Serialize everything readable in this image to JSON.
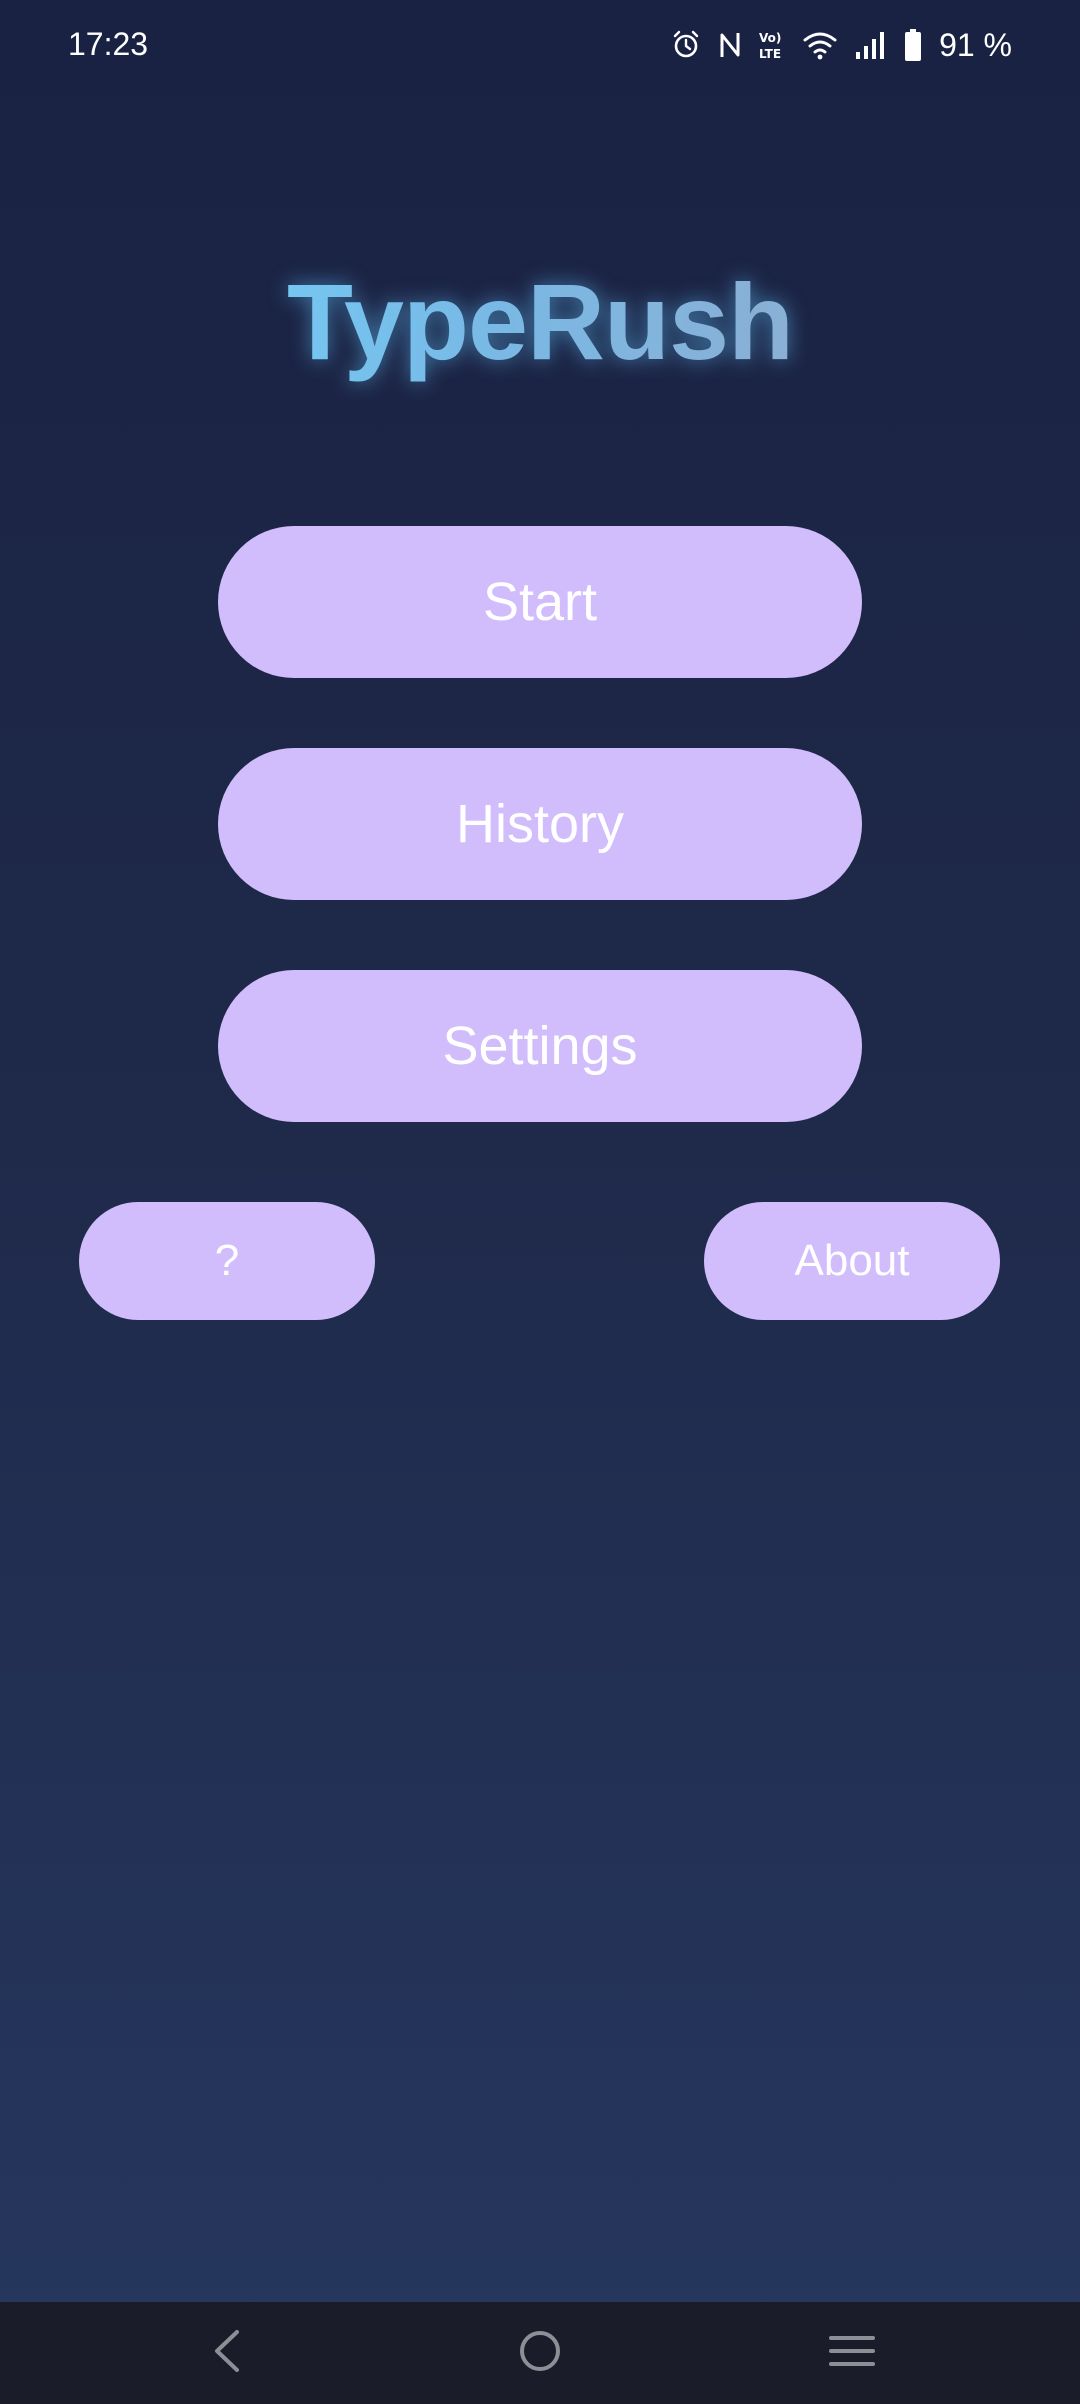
{
  "status_bar": {
    "time": "17:23",
    "battery": "91 %",
    "icons": [
      "alarm-icon",
      "nfc-icon",
      "volte-icon",
      "wifi-icon",
      "signal-icon",
      "battery-icon"
    ]
  },
  "app": {
    "title": "TypeRush"
  },
  "menu": {
    "start_label": "Start",
    "history_label": "History",
    "settings_label": "Settings",
    "help_label": "?",
    "about_label": "About"
  },
  "nav_bar": {
    "icons": [
      "back-icon",
      "home-icon",
      "recents-icon"
    ]
  },
  "colors": {
    "button_bg": "#d1bdfb",
    "button_text": "#ffffff",
    "background_top": "#1a2244",
    "background_bottom": "#26375f",
    "nav_bar_bg": "#1b1c29",
    "title_start": "#6fd8ff",
    "title_end": "#9aa6c4"
  }
}
